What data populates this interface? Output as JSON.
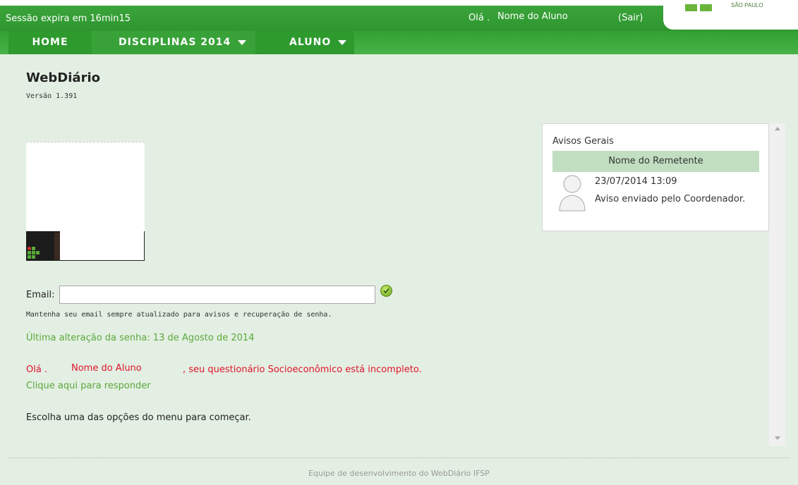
{
  "header": {
    "session": "Sessão expira em 16min15",
    "greeting": "Olá .",
    "user_name": "Nome do Aluno",
    "logout": "(Sair)",
    "logo_text": "SÃO PAULO"
  },
  "nav": {
    "items": [
      {
        "label": "HOME"
      },
      {
        "label": "DISCIPLINAS 2014"
      },
      {
        "label": "ALUNO"
      }
    ]
  },
  "main": {
    "title": "WebDiário",
    "version": "Versão 1.391",
    "email_label": "Email:",
    "email_value": "",
    "email_hint": "Mantenha seu email sempre atualizado para avisos e recuperação de senha.",
    "last_password_change": "Última alteração da senha: 13 de Agosto de 2014",
    "warning_greeting": "Olá .",
    "warning_name": "Nome do Aluno",
    "warning_rest": ", seu questionário Socioeconômico está incompleto.",
    "answer_link": "Clique aqui para responder",
    "choose_option": "Escolha uma das opções do menu para começar."
  },
  "notices": {
    "title": "Avisos Gerais",
    "sender_header": "Nome do Remetente",
    "messages": [
      {
        "date": "23/07/2014 13:09",
        "text": "Aviso enviado pelo Coordenador."
      }
    ]
  },
  "footer": {
    "text": "Equipe de desenvolvimento do WebDiário IFSP"
  },
  "colors": {
    "header_green": "#2f962f",
    "accent_green": "#5aa83a",
    "warning_red": "#e0142a",
    "background": "#e3efe3"
  }
}
